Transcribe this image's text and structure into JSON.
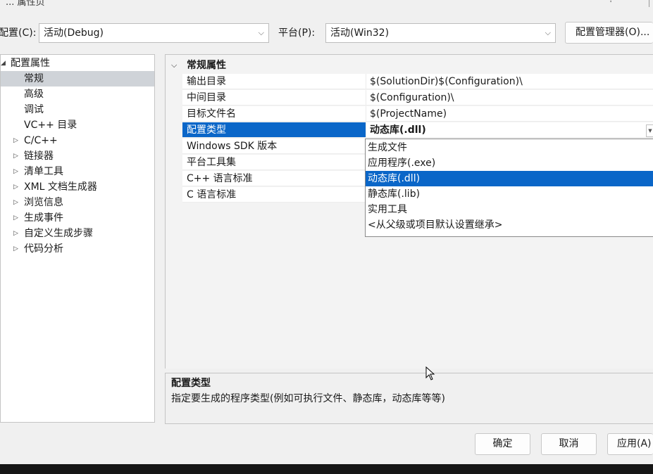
{
  "window": {
    "title": "... 属性页",
    "help": "?"
  },
  "toolbar": {
    "config_label": "配置(C):",
    "config_value": "活动(Debug)",
    "platform_label": "平台(P):",
    "platform_value": "活动(Win32)",
    "config_manager": "配置管理器(O)..."
  },
  "tree": {
    "root": "配置属性",
    "items": [
      {
        "label": "常规",
        "expandable": false,
        "selected": true
      },
      {
        "label": "高级",
        "expandable": false
      },
      {
        "label": "调试",
        "expandable": false
      },
      {
        "label": "VC++ 目录",
        "expandable": false
      },
      {
        "label": "C/C++",
        "expandable": true
      },
      {
        "label": "链接器",
        "expandable": true
      },
      {
        "label": "清单工具",
        "expandable": true
      },
      {
        "label": "XML 文档生成器",
        "expandable": true
      },
      {
        "label": "浏览信息",
        "expandable": true
      },
      {
        "label": "生成事件",
        "expandable": true
      },
      {
        "label": "自定义生成步骤",
        "expandable": true
      },
      {
        "label": "代码分析",
        "expandable": true
      }
    ]
  },
  "grid": {
    "category": "常规属性",
    "rows": [
      {
        "name": "输出目录",
        "value": "$(SolutionDir)$(Configuration)\\"
      },
      {
        "name": "中间目录",
        "value": "$(Configuration)\\"
      },
      {
        "name": "目标文件名",
        "value": "$(ProjectName)"
      },
      {
        "name": "配置类型",
        "value": "动态库(.dll)",
        "selected": true
      },
      {
        "name": "Windows SDK 版本",
        "value": ""
      },
      {
        "name": "平台工具集",
        "value": ""
      },
      {
        "name": "C++ 语言标准",
        "value": ""
      },
      {
        "name": "C 语言标准",
        "value": ""
      }
    ]
  },
  "dropdown": {
    "options": [
      "生成文件",
      "应用程序(.exe)",
      "动态库(.dll)",
      "静态库(.lib)",
      "实用工具",
      "<从父级或项目默认设置继承>"
    ],
    "selected_index": 2
  },
  "description": {
    "title": "配置类型",
    "text": "指定要生成的程序类型(例如可执行文件、静态库，动态库等等)"
  },
  "buttons": {
    "ok": "确定",
    "cancel": "取消",
    "apply": "应用(A)"
  },
  "colors": {
    "selection": "#0a66c8",
    "tree_selection": "#cfd3d8"
  }
}
